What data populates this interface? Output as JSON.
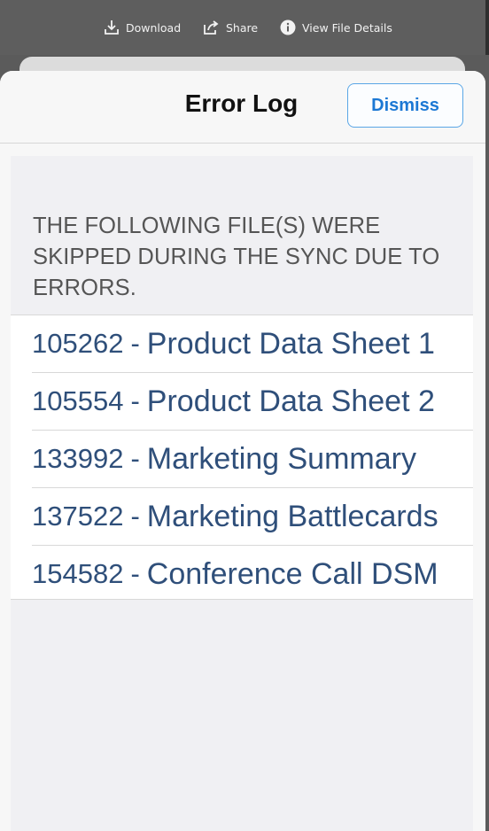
{
  "toolbar": {
    "download": {
      "label": "Download",
      "icon": "download-icon"
    },
    "share": {
      "label": "Share",
      "icon": "share-icon"
    },
    "details": {
      "label": "View File Details",
      "icon": "info-icon"
    }
  },
  "modal": {
    "title": "Error Log",
    "dismiss_label": "Dismiss",
    "notice": "THE FOLLOWING FILE(S) WERE SKIPPED DURING THE SYNC DUE TO ERRORS.",
    "files": [
      {
        "id": "105262",
        "sep": "-",
        "name": "Product Data Sheet 1"
      },
      {
        "id": "105554",
        "sep": "-",
        "name": "Product Data Sheet 2"
      },
      {
        "id": "133992",
        "sep": "-",
        "name": "Marketing Summary"
      },
      {
        "id": "137522",
        "sep": "-",
        "name": "Marketing Battlecards"
      },
      {
        "id": "154582",
        "sep": "-",
        "name": "Conference Call DSM"
      }
    ]
  },
  "colors": {
    "toolbar_bg": "#5e5e5e",
    "accent": "#1c78d4",
    "file_link": "#2f4f7a"
  }
}
